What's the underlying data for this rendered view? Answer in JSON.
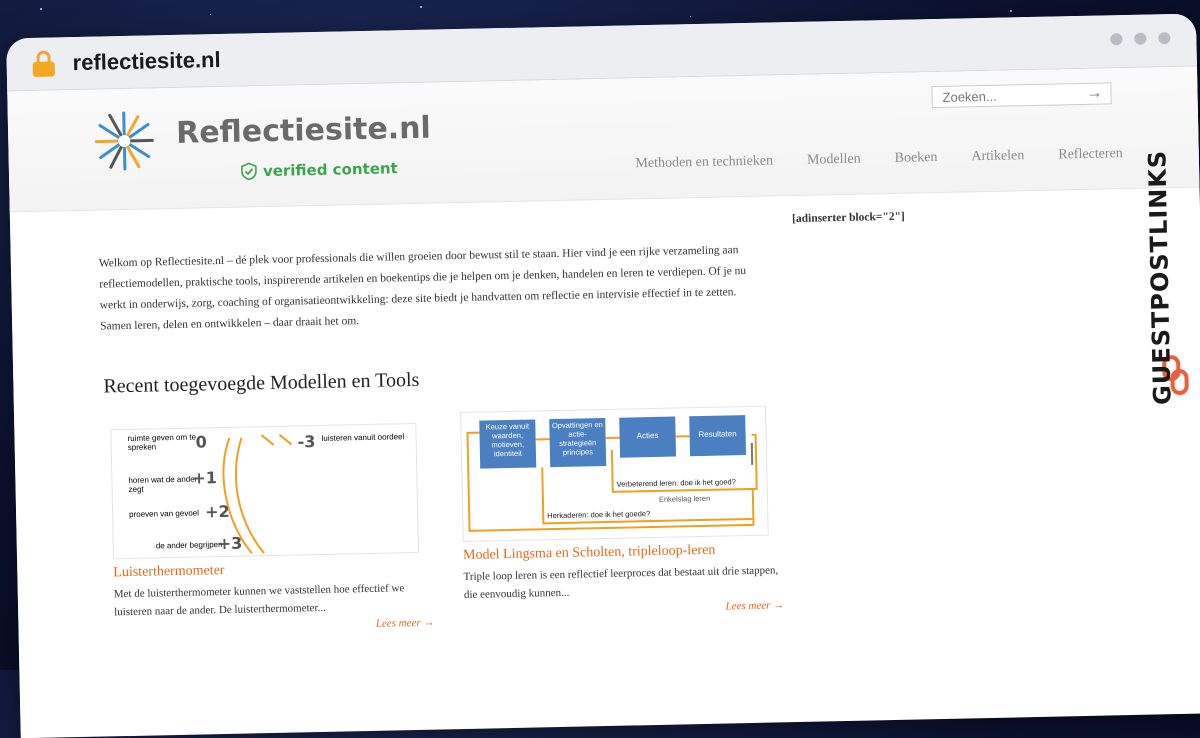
{
  "browser": {
    "url": "reflectiesite.nl"
  },
  "header": {
    "brand": "Reflectiesite.nl",
    "verified": "verified content",
    "search_placeholder": "Zoeken...",
    "nav": [
      "Methoden en technieken",
      "Modellen",
      "Boeken",
      "Artikelen",
      "Reflecteren"
    ]
  },
  "main": {
    "intro": "Welkom op Reflectiesite.nl – dé plek voor professionals die willen groeien door bewust stil te staan. Hier vind je een rijke verzameling aan reflectiemodellen, praktische tools, inspirerende artikelen en boekentips die je helpen om je denken, handelen en leren te verdiepen. Of je nu werkt in onderwijs, zorg, coaching of organisatieontwikkeling: deze site biedt je handvatten om reflectie en intervisie effectief in te zetten. Samen leren, delen en ontwikkelen – daar draait het om.",
    "adinserter": "[adinserter block=\"2\"]",
    "section_title": "Recent toegevoegde Modellen en Tools",
    "cards": [
      {
        "title": "Luisterthermometer",
        "desc": "Met de luisterthermometer kunnen we vaststellen hoe effectief we luisteren naar de ander. De luisterthermometer...",
        "more": "Lees meer →",
        "thumb": {
          "labels": [
            "ruimte geven om te spreken",
            "horen wat de ander zegt",
            "proeven van gevoel",
            "de ander begrijpen",
            "luisteren vanuit oordeel"
          ],
          "scores": [
            "0",
            "+1",
            "+2",
            "+3",
            "-3"
          ]
        }
      },
      {
        "title": "Model Lingsma en Scholten, tripleloop-leren",
        "desc": "Triple loop leren is een reflectief leerproces dat bestaat uit drie stappen, die eenvoudig kunnen...",
        "more": "Lees meer →",
        "thumb": {
          "boxes": [
            "Keuze vanuit waarden, motieven, identiteit",
            "Opvattingen en actie-strategieën principes",
            "Acties",
            "Resultaten"
          ],
          "loops": [
            "Verbeterend leren: doe ik het goed?",
            "Enkelslag leren",
            "Herkaderen: doe ik het goede?"
          ]
        }
      }
    ]
  },
  "watermark": "GUESTPOSTLINKS",
  "colors": {
    "accent": "#e06a1a",
    "verified": "#3aa54a",
    "lock": "#f5a623",
    "diagram_box": "#4a7fc1",
    "diagram_line": "#f0a020"
  }
}
